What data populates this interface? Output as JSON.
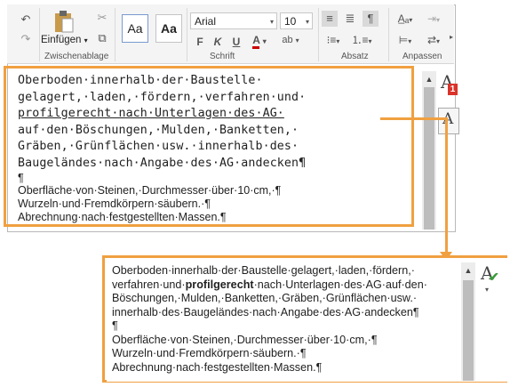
{
  "ribbon": {
    "clipboard": {
      "paste_label": "Einfügen",
      "group_label": "Zwischenablage"
    },
    "styles": {
      "style1": "Aa",
      "style2": "Aa"
    },
    "font": {
      "name": "Arial",
      "size": "10",
      "group_label": "Schrift",
      "bold": "F",
      "italic": "K",
      "underline": "U",
      "color": "A",
      "highlight": "ab"
    },
    "paragraph": {
      "group_label": "Absatz",
      "pilcrow": "¶"
    },
    "adjust": {
      "group_label": "Anpassen"
    }
  },
  "editor_top": {
    "mono_lines": [
      "Oberboden·innerhalb·der·Baustelle·",
      "gelagert,·laden,·fördern,·verfahren·und·",
      "profilgerecht·nach·Unterlagen·des·AG·",
      "auf·den·Böschungen,·Mulden,·Banketten,·",
      "Gräben,·Grünflächen·usw.·innerhalb·des·",
      "Baugeländes·nach·Angabe·des·AG·andecken¶"
    ],
    "pilcrow": "¶",
    "sans_lines": [
      "Oberfläche·von·Steinen,·Durchmesser·über·10·cm,·¶",
      "Wurzeln·und·Fremdkörpern·säubern.·¶",
      "Abrechnung·nach·festgestellten·Massen.¶"
    ]
  },
  "editor_bottom": {
    "line1": "Oberboden·innerhalb·der·Baustelle·gelagert,·laden,·fördern,·",
    "line2_pre": "verfahren·und·",
    "line2_bold": "profilgerecht",
    "line2_post": "·nach·Unterlagen·des·AG·auf·den·",
    "line3": "Böschungen,·Mulden,·Banketten,·Gräben,·Grünflächen·usw.·",
    "line4": "innerhalb·des·Baugeländes·nach·Angabe·des·AG·andecken¶",
    "line5": "¶",
    "line6": "Oberfläche·von·Steinen,·Durchmesser·über·10·cm,·¶",
    "line7": "Wurzeln·und·Fremdkörpern·säubern.·¶",
    "line8": "Abrechnung·nach·festgestellten·Massen.¶"
  },
  "side_icons": {
    "font_warning": "A",
    "badge": "1",
    "convert": "A",
    "fixed": "A"
  },
  "colors": {
    "accent_orange": "#f0a040",
    "badge_red": "#d9332b",
    "check_green": "#3a9a3a"
  }
}
